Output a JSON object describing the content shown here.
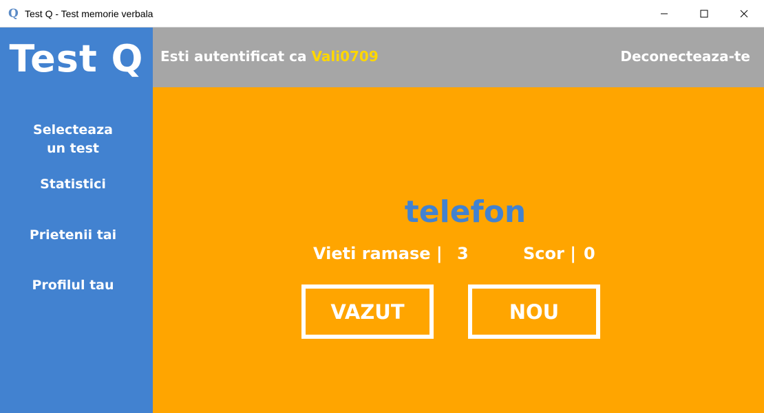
{
  "window": {
    "title": "Test Q - Test memorie verbala",
    "icon_letter": "Q",
    "controls": [
      "minimize-icon",
      "maximize-icon",
      "close-icon"
    ]
  },
  "sidebar": {
    "logo": "Test Q",
    "items": [
      {
        "label": "Selecteaza\nun test",
        "line1": "Selecteaza",
        "line2": "un test"
      },
      {
        "label": "Statistici"
      },
      {
        "label": "Prietenii tai"
      },
      {
        "label": "Profilul tau"
      }
    ]
  },
  "header": {
    "auth_prefix": "Esti autentificat ca ",
    "username": "Vali0709",
    "logout_label": "Deconecteaza-te"
  },
  "main": {
    "word": "telefon",
    "lives_label": "Vieti ramase |",
    "lives_value": "3",
    "score_label": "Scor |",
    "score_value": "0",
    "seen_button": "VAZUT",
    "new_button": "NOU"
  },
  "colors": {
    "sidebar": "#4282d0",
    "header": "#a6a6a6",
    "main": "#ffa500",
    "username": "#ffd700",
    "word": "#4282d0",
    "text": "#ffffff"
  }
}
